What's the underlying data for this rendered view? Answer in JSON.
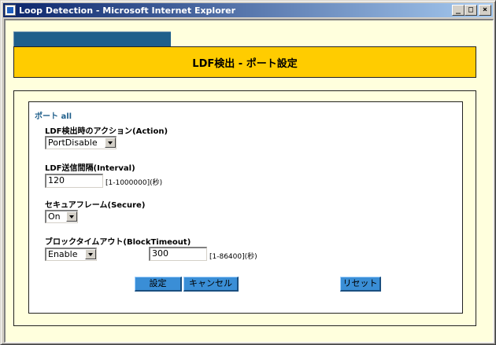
{
  "window": {
    "title": "Loop Detection - Microsoft Internet Explorer",
    "minimize": "_",
    "maximize": "□",
    "close": "×"
  },
  "header": {
    "title": "LDF検出 - ポート設定"
  },
  "form": {
    "port_label": "ポート all",
    "action": {
      "label": "LDF検出時のアクション(Action)",
      "value": "PortDisable"
    },
    "interval": {
      "label": "LDF送信間隔(Interval)",
      "value": "120",
      "hint": "[1-1000000](秒)"
    },
    "secure": {
      "label": "セキュアフレーム(Secure)",
      "value": "On"
    },
    "block_timeout": {
      "label": "ブロックタイムアウト(BlockTimeout)",
      "select_value": "Enable",
      "value": "300",
      "hint": "[1-86400](秒)"
    }
  },
  "buttons": {
    "set": "設定",
    "cancel": "キャンセル",
    "reset": "リセット"
  },
  "colors": {
    "header_bg": "#ffcc00",
    "tab_bg": "#1f5f8b",
    "page_bg": "#ffffdd",
    "button_bg": "#3a8ed6"
  }
}
